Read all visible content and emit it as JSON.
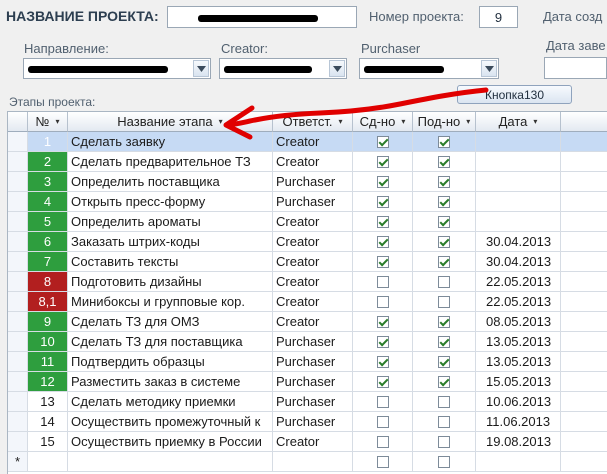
{
  "header": {
    "project_name_label": "НАЗВАНИЕ ПРОЕКТА:",
    "project_number_label": "Номер проекта:",
    "project_number_value": "9",
    "created_date_label": "Дата созд",
    "end_date_label": "Дата заве"
  },
  "filters": {
    "direction_label": "Направление:",
    "creator_label": "Creator:",
    "purchaser_label": "Purchaser"
  },
  "stages_label": "Этапы проекта:",
  "button_label": "Кнопка130",
  "grid": {
    "headers": [
      "№",
      "Название этапа",
      "Ответст.",
      "Сд-но",
      "Под-но",
      "Дата"
    ],
    "new_row_marker": "*",
    "rows": [
      {
        "num": "1",
        "name": "Сделать заявку",
        "resp": "Creator",
        "done": true,
        "signed": true,
        "date": "",
        "color": "green"
      },
      {
        "num": "2",
        "name": "Сделать предварительное ТЗ",
        "resp": "Creator",
        "done": true,
        "signed": true,
        "date": "",
        "color": "green"
      },
      {
        "num": "3",
        "name": "Определить поставщика",
        "resp": "Purchaser",
        "done": true,
        "signed": true,
        "date": "",
        "color": "green"
      },
      {
        "num": "4",
        "name": "Открыть пресс-форму",
        "resp": "Purchaser",
        "done": true,
        "signed": true,
        "date": "",
        "color": "green"
      },
      {
        "num": "5",
        "name": "Определить ароматы",
        "resp": "Creator",
        "done": true,
        "signed": true,
        "date": "",
        "color": "green"
      },
      {
        "num": "6",
        "name": "Заказать штрих-коды",
        "resp": "Creator",
        "done": true,
        "signed": true,
        "date": "30.04.2013",
        "color": "green"
      },
      {
        "num": "7",
        "name": "Составить тексты",
        "resp": "Creator",
        "done": true,
        "signed": true,
        "date": "30.04.2013",
        "color": "green"
      },
      {
        "num": "8",
        "name": "Подготовить дизайны",
        "resp": "Creator",
        "done": false,
        "signed": false,
        "date": "22.05.2013",
        "color": "red"
      },
      {
        "num": "8,1",
        "name": "Минибоксы и групповые кор.",
        "resp": "Creator",
        "done": false,
        "signed": false,
        "date": "22.05.2013",
        "color": "red"
      },
      {
        "num": "9",
        "name": "Сделать ТЗ для ОМЗ",
        "resp": "Creator",
        "done": true,
        "signed": true,
        "date": "08.05.2013",
        "color": "green"
      },
      {
        "num": "10",
        "name": "Сделать ТЗ для поставщика",
        "resp": "Purchaser",
        "done": true,
        "signed": true,
        "date": "13.05.2013",
        "color": "green"
      },
      {
        "num": "11",
        "name": "Подтвердить образцы",
        "resp": "Purchaser",
        "done": true,
        "signed": true,
        "date": "13.05.2013",
        "color": "green"
      },
      {
        "num": "12",
        "name": "Разместить заказ в системе",
        "resp": "Purchaser",
        "done": true,
        "signed": true,
        "date": "15.05.2013",
        "color": "green"
      },
      {
        "num": "13",
        "name": "Сделать методику приемки",
        "resp": "Purchaser",
        "done": false,
        "signed": false,
        "date": "10.06.2013",
        "color": "none"
      },
      {
        "num": "14",
        "name": "Осуществить промежуточный к",
        "resp": "Purchaser",
        "done": false,
        "signed": false,
        "date": "11.06.2013",
        "color": "none"
      },
      {
        "num": "15",
        "name": "Осуществить приемку в России",
        "resp": "Creator",
        "done": false,
        "signed": false,
        "date": "19.08.2013",
        "color": "none"
      }
    ]
  },
  "colors": {
    "green": "#2e9e3e",
    "red": "#b21f1f",
    "annotation_arrow": "#e00000",
    "selected_row": "#c6daf4"
  },
  "icons": {
    "dropdown": "chevron-down-icon",
    "sort": "sort-arrow-icon",
    "checkbox": "checkbox-icon"
  }
}
